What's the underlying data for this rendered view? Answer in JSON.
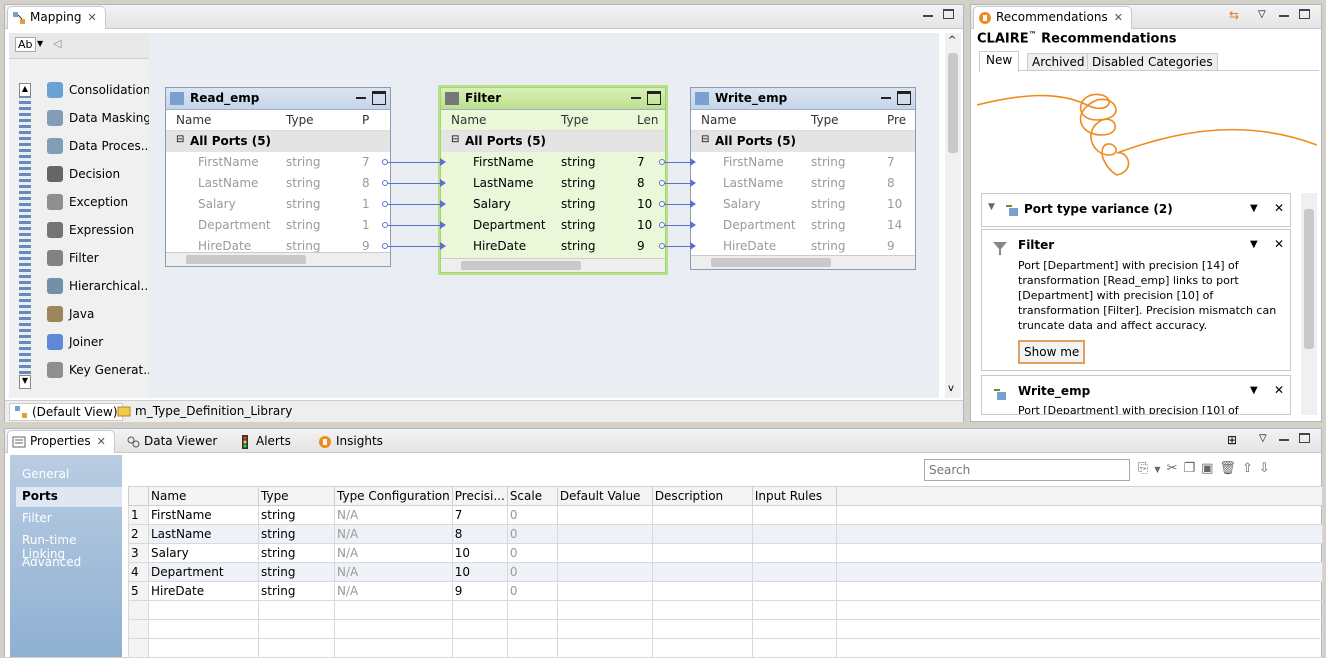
{
  "mapping": {
    "tab": "Mapping",
    "bottom_tabs": [
      "(Default View)",
      "m_Type_Definition_Library"
    ],
    "palette": [
      "Consolidation",
      "Data Masking",
      "Data Proces...",
      "Decision",
      "Exception",
      "Expression",
      "Filter",
      "Hierarchical...",
      "Java",
      "Joiner",
      "Key Generat..."
    ],
    "read": {
      "title": "Read_emp",
      "col_name": "Name",
      "col_type": "Type",
      "col_third": "P",
      "group": "All Ports (5)",
      "rows": [
        {
          "n": "FirstName",
          "t": "string",
          "p": "7"
        },
        {
          "n": "LastName",
          "t": "string",
          "p": "8"
        },
        {
          "n": "Salary",
          "t": "string",
          "p": "1"
        },
        {
          "n": "Department",
          "t": "string",
          "p": "1"
        },
        {
          "n": "HireDate",
          "t": "string",
          "p": "9"
        }
      ]
    },
    "filter": {
      "title": "Filter",
      "col_name": "Name",
      "col_type": "Type",
      "col_third": "Len",
      "group": "All Ports (5)",
      "rows": [
        {
          "n": "FirstName",
          "t": "string",
          "p": "7"
        },
        {
          "n": "LastName",
          "t": "string",
          "p": "8"
        },
        {
          "n": "Salary",
          "t": "string",
          "p": "10"
        },
        {
          "n": "Department",
          "t": "string",
          "p": "10"
        },
        {
          "n": "HireDate",
          "t": "string",
          "p": "9"
        }
      ]
    },
    "write": {
      "title": "Write_emp",
      "col_name": "Name",
      "col_type": "Type",
      "col_third": "Pre",
      "group": "All Ports (5)",
      "rows": [
        {
          "n": "FirstName",
          "t": "string",
          "p": "7"
        },
        {
          "n": "LastName",
          "t": "string",
          "p": "8"
        },
        {
          "n": "Salary",
          "t": "string",
          "p": "10"
        },
        {
          "n": "Department",
          "t": "string",
          "p": "14"
        },
        {
          "n": "HireDate",
          "t": "string",
          "p": "9"
        }
      ]
    }
  },
  "recs": {
    "tab": "Recommendations",
    "brand": "CLAIRE",
    "tm": "™",
    "title": " Recommendations",
    "tabs": [
      "New",
      "Archived",
      "Disabled Categories"
    ],
    "group": "Port type variance (2)",
    "card1": {
      "title": "Filter",
      "text": "Port [Department] with precision [14] of transformation [Read_emp] links to port [Department] with precision [10] of transformation [Filter]. Precision mismatch can truncate data and affect accuracy.",
      "button": "Show me"
    },
    "card2": {
      "title": "Write_emp",
      "text": "Port [Department] with precision [10] of"
    }
  },
  "bottom": {
    "tabs": [
      "Properties",
      "Data Viewer",
      "Alerts",
      "Insights"
    ],
    "nav": [
      "General",
      "Ports",
      "Filter",
      "Run-time Linking",
      "Advanced"
    ],
    "search_placeholder": "Search",
    "headers": [
      "",
      "Name",
      "Type",
      "Type Configuration",
      "Precisi...",
      "Scale",
      "Default Value",
      "Description",
      "Input Rules"
    ],
    "rows": [
      [
        "1",
        "FirstName",
        "string",
        "N/A",
        "7",
        "0"
      ],
      [
        "2",
        "LastName",
        "string",
        "N/A",
        "8",
        "0"
      ],
      [
        "3",
        "Salary",
        "string",
        "N/A",
        "10",
        "0"
      ],
      [
        "4",
        "Department",
        "string",
        "N/A",
        "10",
        "0"
      ],
      [
        "5",
        "HireDate",
        "string",
        "N/A",
        "9",
        "0"
      ]
    ]
  },
  "colors": {
    "accent": "#5b6fd6",
    "selected": "#bde08c",
    "claire_orange": "#f08a1c"
  }
}
